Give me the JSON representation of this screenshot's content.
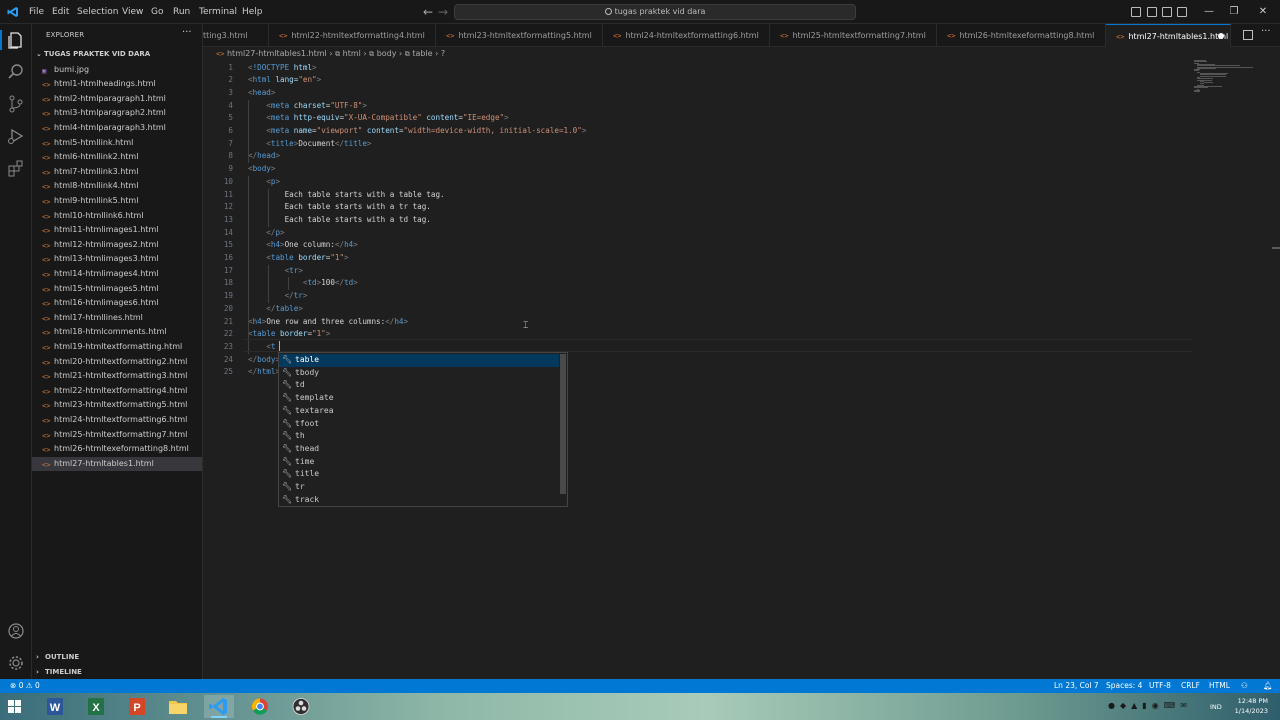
{
  "menu": [
    "File",
    "Edit",
    "Selection",
    "View",
    "Go",
    "Run",
    "Terminal",
    "Help"
  ],
  "search_text": "tugas praktek vid dara",
  "explorer": {
    "title": "EXPLORER",
    "folder": "TUGAS PRAKTEK VID DARA",
    "files": [
      "bumi.jpg",
      "html1-htmlheadings.html",
      "html2-htmlparagraph1.html",
      "html3-htmlparagraph2.html",
      "html4-htmlparagraph3.html",
      "html5-htmllink.html",
      "html6-htmllink2.html",
      "html7-htmllink3.html",
      "html8-htmllink4.html",
      "html9-htmllink5.html",
      "html10-htmllink6.html",
      "html11-htmlimages1.html",
      "html12-htmlimages2.html",
      "html13-htmlimages3.html",
      "html14-htmlimages4.html",
      "html15-htmlimages5.html",
      "html16-htmlimages6.html",
      "html17-htmllines.html",
      "html18-htmlcomments.html",
      "html19-htmltextformatting.html",
      "html20-htmltextformatting2.html",
      "html21-htmltextformatting3.html",
      "html22-htmltextformatting4.html",
      "html23-htmltextformatting5.html",
      "html24-htmltextformatting6.html",
      "html25-htmltextformatting7.html",
      "html26-htmltexeformatting8.html",
      "html27-htmltables1.html"
    ],
    "outline": "OUTLINE",
    "timeline": "TIMELINE"
  },
  "tabs": [
    "tting3.html",
    "html22-htmltextformatting4.html",
    "html23-htmltextformatting5.html",
    "html24-htmltextformatting6.html",
    "html25-htmltextformatting7.html",
    "html26-htmltexeformatting8.html",
    "html27-htmltables1.html"
  ],
  "breadcrumb": [
    "html27-htmltables1.html",
    "html",
    "body",
    "table",
    "?"
  ],
  "code_lines": [
    "<!DOCTYPE html>",
    "<html lang=\"en\">",
    "<head>",
    "    <meta charset=\"UTF-8\">",
    "    <meta http-equiv=\"X-UA-Compatible\" content=\"IE=edge\">",
    "    <meta name=\"viewport\" content=\"width=device-width, initial-scale=1.0\">",
    "    <title>Document</title>",
    "</head>",
    "<body>",
    "    <p>",
    "        Each table starts with a table tag.",
    "        Each table starts with a tr tag.",
    "        Each table starts with a td tag.",
    "    </p>",
    "    <h4>One column:</h4>",
    "    <table border=\"1\">",
    "        <tr>",
    "            <td>100</td>",
    "        </tr>",
    "    </table>",
    "<h4>One row and three columns:</h4>",
    "<table border=\"1\">",
    "    <t",
    "</body>",
    "</html>"
  ],
  "suggestions": [
    "table",
    "tbody",
    "td",
    "template",
    "textarea",
    "tfoot",
    "th",
    "thead",
    "time",
    "title",
    "tr",
    "track"
  ],
  "status": {
    "errors": "0",
    "warnings": "0",
    "position": "Ln 23, Col 7",
    "spaces": "Spaces: 4",
    "encoding": "UTF-8",
    "eol": "CRLF",
    "language": "HTML"
  },
  "taskbar": {
    "lang": "IND",
    "time": "12:48 PM",
    "date": "1/14/2023"
  },
  "colors": {
    "accent": "#0078d4",
    "html_icon": "#e37933",
    "tag": "#569cd6",
    "attr": "#9cdcfe",
    "string": "#ce9178"
  }
}
